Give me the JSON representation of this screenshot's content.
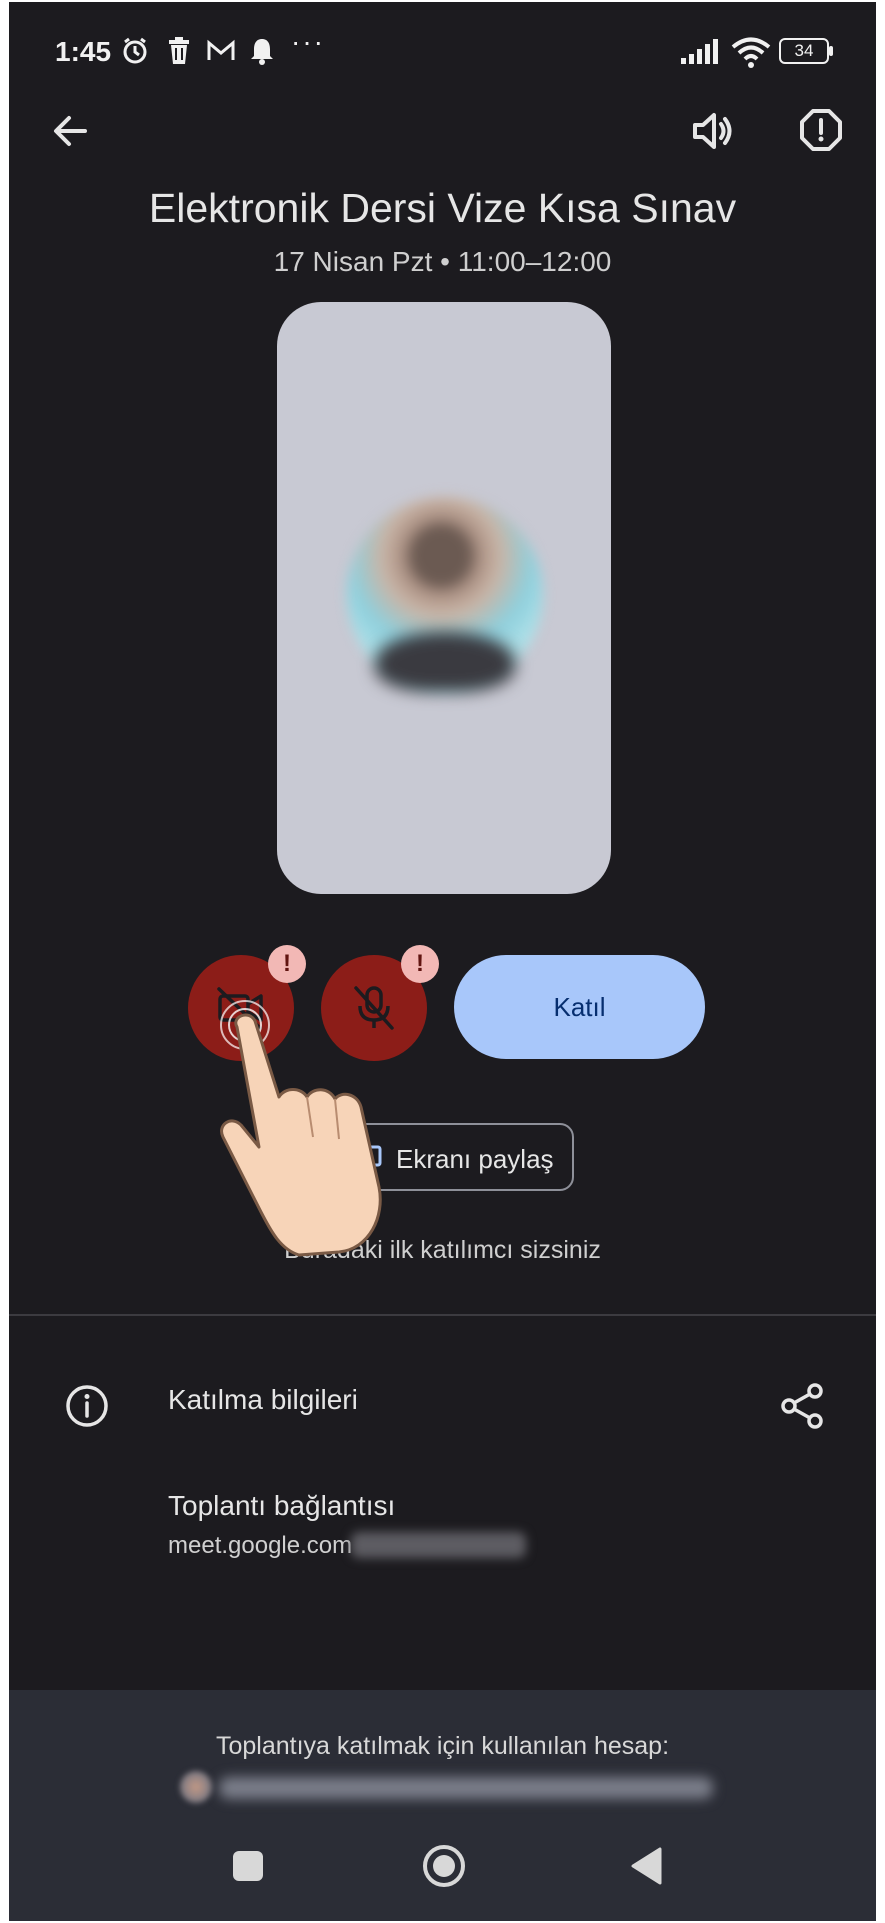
{
  "status_bar": {
    "time": "1:45",
    "more_indicator": "···",
    "battery_level": "34",
    "icons": [
      "alarm-icon",
      "trash-icon",
      "gmail-icon",
      "bell-icon",
      "signal-icon",
      "wifi-icon",
      "battery-icon"
    ]
  },
  "app_bar": {
    "icons": [
      "back-arrow-icon",
      "speaker-icon",
      "report-icon"
    ]
  },
  "meeting": {
    "title": "Elektronik Dersi Vize Kısa Sınav",
    "schedule": "17 Nisan Pzt • 11:00–12:00"
  },
  "controls": {
    "camera_badge": "!",
    "mic_badge": "!",
    "join_label": "Katıl",
    "share_screen_label": "Ekranı paylaş",
    "first_participant_text": "Buradaki ilk katılımcı sizsiniz",
    "off_color": "#8c1d18",
    "join_color": "#a8c7fa"
  },
  "join_info": {
    "title": "Katılma bilgileri",
    "link_title": "Toplantı bağlantısı",
    "link_url": "meet.google.com"
  },
  "account": {
    "label": "Toplantıya katılmak için kullanılan hesap:"
  },
  "nav_bar": {
    "icons": [
      "recents-square-icon",
      "home-circle-icon",
      "back-triangle-icon"
    ]
  }
}
